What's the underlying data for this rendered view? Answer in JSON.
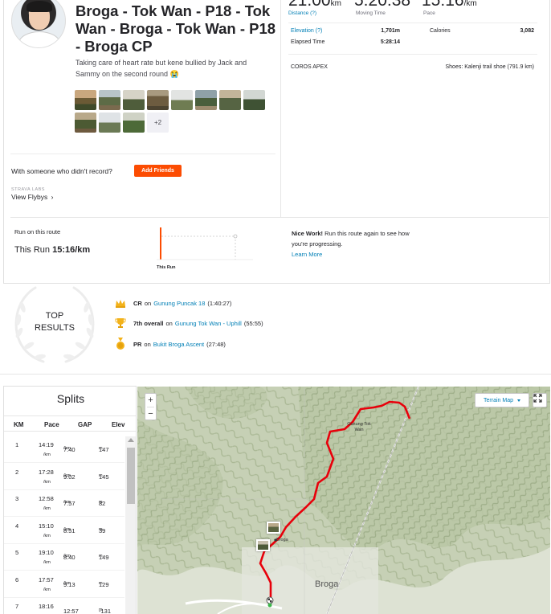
{
  "activity": {
    "title": "Broga - Tok Wan - P18 - Tok Wan - Broga - Tok Wan - P18 - Broga CP",
    "description": "Taking care of heart rate but kene bullied by Jack and Sammy on the second round 😭",
    "more_photos": "+2",
    "with_someone": "With someone who didn't record?",
    "add_friends": "Add Friends",
    "strava_labs": "STRAVA LABS",
    "view_flybys": "View Flybys",
    "flybys_chevron": "›"
  },
  "stats": {
    "distance_value": "21.00",
    "distance_unit": "km",
    "distance_label": "Distance (?)",
    "moving_time_value": "5:20:38",
    "moving_time_label": "Moving Time",
    "pace_value": "15:16",
    "pace_unit": "/km",
    "pace_label": "Pace",
    "elevation_label": "Elevation (?)",
    "elevation_value": "1,701m",
    "calories_label": "Calories",
    "calories_value": "3,082",
    "elapsed_label": "Elapsed Time",
    "elapsed_value": "5:28:14",
    "device": "COROS APEX",
    "shoes": "Shoes: Kalenji trail shoe (791.9 km)"
  },
  "route": {
    "label": "Run on this route",
    "this_run_prefix": "This Run",
    "this_run_pace": "15:16/km",
    "chart_label": "This Run",
    "nice_work_bold": "Nice Work!",
    "nice_work_text": " Run this route again to see how you're progressing.",
    "learn_more": "Learn More"
  },
  "top_results": {
    "title_line1": "TOP",
    "title_line2": "RESULTS",
    "items": [
      {
        "icon": "crown-icon",
        "rank": "CR",
        "on": "on",
        "segment": "Gunung Puncak 18",
        "time": "(1:40:27)"
      },
      {
        "icon": "trophy-icon",
        "rank": "7th overall",
        "on": "on",
        "segment": "Gunung Tok Wan - Uphill",
        "time": "(55:55)"
      },
      {
        "icon": "pr-medal-icon",
        "rank": "PR",
        "on": "on",
        "segment": "Bukit Broga Ascent",
        "time": "(27:48)"
      }
    ]
  },
  "splits": {
    "title": "Splits",
    "headers": [
      "KM",
      "Pace",
      "GAP",
      "Elev"
    ],
    "rows": [
      {
        "km": "1",
        "pace": "14:19",
        "gap": "7:40",
        "gap_unit": "/km",
        "elev": "147",
        "elev_unit": "m",
        "per": "/km"
      },
      {
        "km": "2",
        "pace": "17:28",
        "gap": "9:02",
        "gap_unit": "/km",
        "elev": "145",
        "elev_unit": "m",
        "per": "/km"
      },
      {
        "km": "3",
        "pace": "12:58",
        "gap": "7:57",
        "gap_unit": "/km",
        "elev": "82",
        "elev_unit": "m",
        "per": "/km"
      },
      {
        "km": "4",
        "pace": "15:10",
        "gap": "8:51",
        "gap_unit": "/km",
        "elev": "39",
        "elev_unit": "m",
        "per": "/km"
      },
      {
        "km": "5",
        "pace": "19:10",
        "gap": "8:40",
        "gap_unit": "/km",
        "elev": "149",
        "elev_unit": "m",
        "per": "/km"
      },
      {
        "km": "6",
        "pace": "17:57",
        "gap": "9:13",
        "gap_unit": "/km",
        "elev": "129",
        "elev_unit": "m",
        "per": "/km"
      },
      {
        "km": "7",
        "pace": "18:16",
        "gap": "12:57",
        "gap_unit": "",
        "elev": "-131",
        "elev_unit": "m",
        "per": "/km",
        "gap_sub": "/km"
      }
    ]
  },
  "map": {
    "zoom_in": "+",
    "zoom_out": "−",
    "terrain_label": "Terrain Map",
    "peak_label_line1": "Gunung Tok",
    "peak_label_line2": "Wan",
    "broga_marker_label": "Broga",
    "town_label": "Broga",
    "route_color": "#e8000b"
  },
  "colors": {
    "brand_orange": "#fc4c02",
    "link_blue": "#007fb6"
  }
}
